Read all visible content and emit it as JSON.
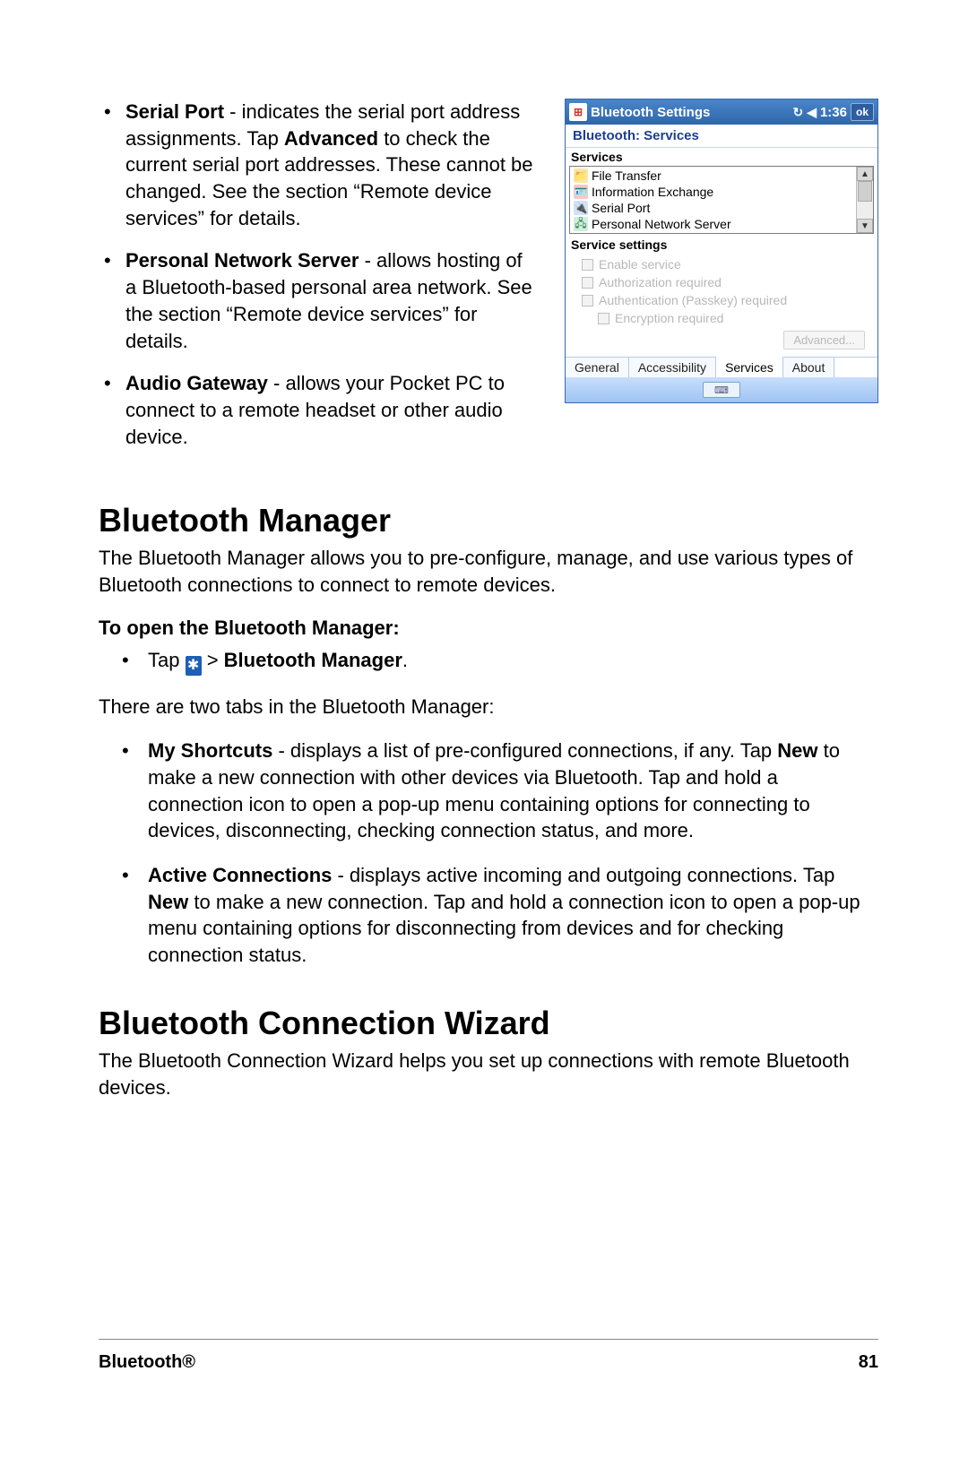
{
  "bullets_top": {
    "serial_port": {
      "label": "Serial Port",
      "t1": " - indicates the serial port address assignments. Tap ",
      "adv": "Advanced",
      "t2": " to check the current serial port addresses.  These cannot be changed.  See the section “Remote device services” for details."
    },
    "pns": {
      "label": "Personal Network Server",
      "text": " - allows hosting of a Bluetooth-based personal area network. See the section “Remote device services” for details."
    },
    "audio": {
      "label": "Audio Gateway",
      "text": " - allows your Pocket PC to connect to a remote headset or other audio device."
    }
  },
  "h_manager": "Bluetooth Manager",
  "p_manager": "The Bluetooth Manager allows you to pre-configure, manage, and use various types of Bluetooth connections to connect to remote devices.",
  "sub_open": "To open the Bluetooth Manager:",
  "open_tap": "Tap ",
  "open_arrow": " > ",
  "open_label": "Bluetooth Manager",
  "open_period": ".",
  "tabs_intro": "There are two tabs in the Bluetooth Manager:",
  "tabs": {
    "shortcuts": {
      "label": "My Shortcuts",
      "t1": " - displays a list of pre-configured connections, if any. Tap ",
      "new": "New",
      "t2": " to make a new connection with other devices via Bluetooth. Tap and hold a connection icon to open a pop-up menu containing options for connecting to devices, disconnecting, checking connection status, and more."
    },
    "active": {
      "label": "Active Connections",
      "t1": " - displays active incoming and outgoing connections. Tap ",
      "new": "New",
      "t2": " to make a new connection. Tap and hold a connection icon to open a pop-up menu containing options for disconnecting from devices and for checking connection status."
    }
  },
  "h_wizard": "Bluetooth Connection Wizard",
  "p_wizard": "The Bluetooth Connection Wizard helps you set up connections with remote Bluetooth devices.",
  "footer_left": "Bluetooth®",
  "footer_right": "81",
  "shot": {
    "title": "Bluetooth Settings",
    "time": "1:36",
    "ok": "ok",
    "subtitle": "Bluetooth: Services",
    "services_label": "Services",
    "services": [
      "File Transfer",
      "Information Exchange",
      "Serial Port",
      "Personal Network Server"
    ],
    "settings_label": "Service settings",
    "checks": {
      "c0": "Enable service",
      "c1": "Authorization required",
      "c2": "Authentication (Passkey) required",
      "c3": "Encryption required"
    },
    "advanced": "Advanced...",
    "tabs": [
      "General",
      "Accessibility",
      "Services",
      "About"
    ]
  }
}
